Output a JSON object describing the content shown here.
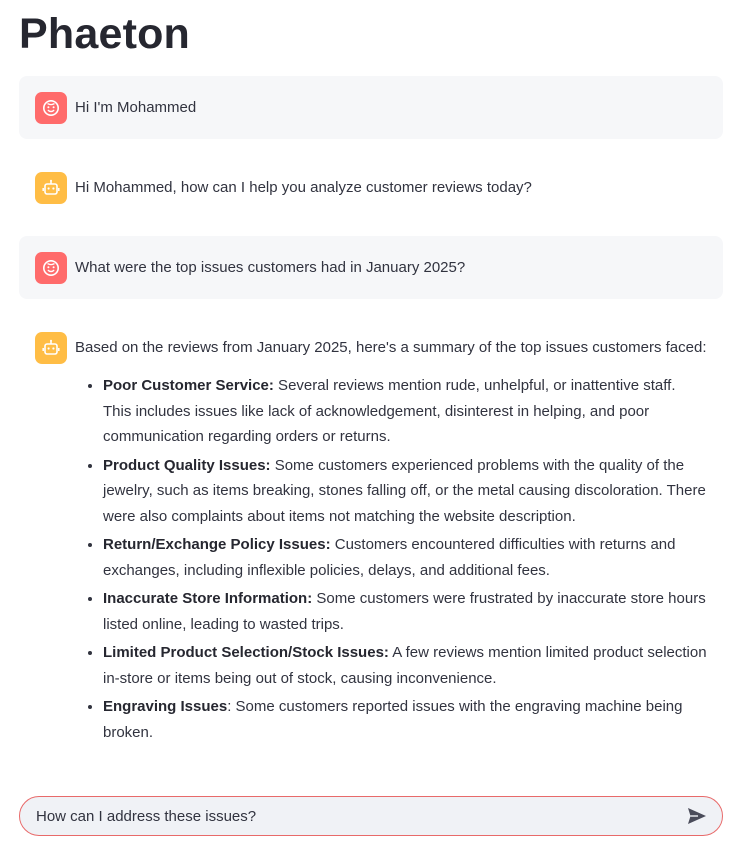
{
  "app": {
    "title": "Phaeton"
  },
  "messages": [
    {
      "role": "user",
      "text": "Hi I'm Mohammed"
    },
    {
      "role": "assistant",
      "text": "Hi Mohammed, how can I help you analyze customer reviews today?"
    },
    {
      "role": "user",
      "text": "What were the top issues customers had in January 2025?"
    },
    {
      "role": "assistant",
      "intro": "Based on the reviews from January 2025, here's a summary of the top issues customers faced:",
      "items": [
        {
          "title": "Poor Customer Service:",
          "text": " Several reviews mention rude, unhelpful, or inattentive staff. This includes issues like lack of acknowledgement, disinterest in helping, and poor communication regarding orders or returns."
        },
        {
          "title": "Product Quality Issues:",
          "text": " Some customers experienced problems with the quality of the jewelry, such as items breaking, stones falling off, or the metal causing discoloration. There were also complaints about items not matching the website description."
        },
        {
          "title": "Return/Exchange Policy Issues:",
          "text": " Customers encountered difficulties with returns and exchanges, including inflexible policies, delays, and additional fees."
        },
        {
          "title": "Inaccurate Store Information:",
          "text": " Some customers were frustrated by inaccurate store hours listed online, leading to wasted trips."
        },
        {
          "title": "Limited Product Selection/Stock Issues:",
          "text": " A few reviews mention limited product selection in-store or items being out of stock, causing inconvenience."
        },
        {
          "title": "Engraving Issues",
          "text": ": Some customers reported issues with the engraving machine being broken."
        }
      ]
    }
  ],
  "chat_input": {
    "value": "How can I address these issues?"
  },
  "colors": {
    "user_avatar": "#ff6b6b",
    "assistant_avatar": "#ffbd45",
    "input_border": "#e86a6a"
  },
  "icons": {
    "user": "face-icon",
    "assistant": "robot-icon",
    "send": "send-arrow-icon"
  }
}
